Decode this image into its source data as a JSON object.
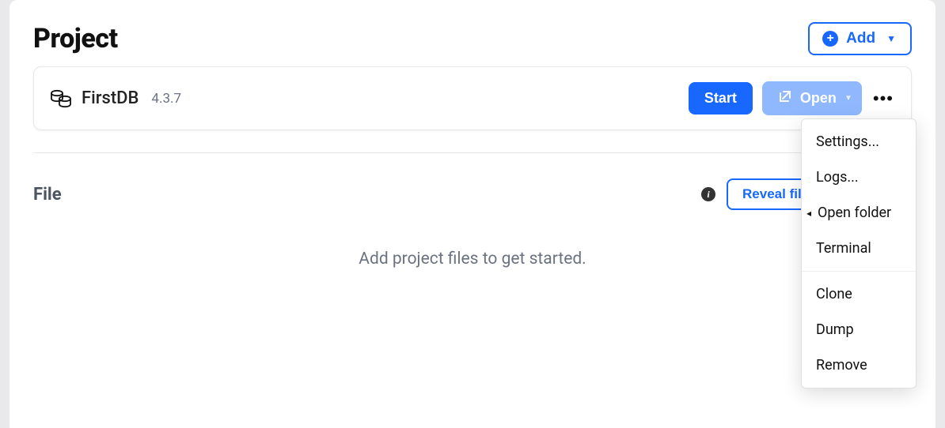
{
  "header": {
    "title": "Project",
    "add_label": "Add"
  },
  "project": {
    "icon_name": "database-icon",
    "name": "FirstDB",
    "version": "4.3.7",
    "start_label": "Start",
    "open_label": "Open"
  },
  "file_section": {
    "heading": "File",
    "reveal_label": "Reveal files in Finder",
    "empty_state": "Add project files to get started."
  },
  "context_menu": {
    "items_top": [
      {
        "label": "Settings...",
        "name": "menu-settings"
      },
      {
        "label": "Logs...",
        "name": "menu-logs"
      },
      {
        "label": "Open folder",
        "name": "menu-open-folder",
        "submenu": true
      },
      {
        "label": "Terminal",
        "name": "menu-terminal"
      }
    ],
    "items_bottom": [
      {
        "label": "Clone",
        "name": "menu-clone"
      },
      {
        "label": "Dump",
        "name": "menu-dump"
      },
      {
        "label": "Remove",
        "name": "menu-remove"
      }
    ]
  }
}
